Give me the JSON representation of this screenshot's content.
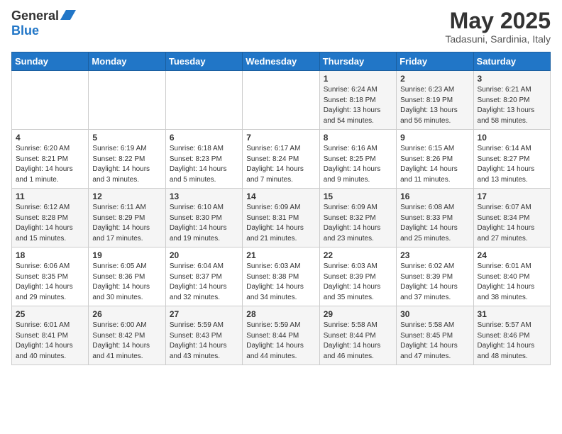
{
  "header": {
    "logo_general": "General",
    "logo_blue": "Blue",
    "month_title": "May 2025",
    "subtitle": "Tadasuni, Sardinia, Italy"
  },
  "days_of_week": [
    "Sunday",
    "Monday",
    "Tuesday",
    "Wednesday",
    "Thursday",
    "Friday",
    "Saturday"
  ],
  "weeks": [
    [
      {
        "day": "",
        "sunrise": "",
        "sunset": "",
        "daylight": ""
      },
      {
        "day": "",
        "sunrise": "",
        "sunset": "",
        "daylight": ""
      },
      {
        "day": "",
        "sunrise": "",
        "sunset": "",
        "daylight": ""
      },
      {
        "day": "",
        "sunrise": "",
        "sunset": "",
        "daylight": ""
      },
      {
        "day": "1",
        "sunrise": "Sunrise: 6:24 AM",
        "sunset": "Sunset: 8:18 PM",
        "daylight": "Daylight: 13 hours and 54 minutes."
      },
      {
        "day": "2",
        "sunrise": "Sunrise: 6:23 AM",
        "sunset": "Sunset: 8:19 PM",
        "daylight": "Daylight: 13 hours and 56 minutes."
      },
      {
        "day": "3",
        "sunrise": "Sunrise: 6:21 AM",
        "sunset": "Sunset: 8:20 PM",
        "daylight": "Daylight: 13 hours and 58 minutes."
      }
    ],
    [
      {
        "day": "4",
        "sunrise": "Sunrise: 6:20 AM",
        "sunset": "Sunset: 8:21 PM",
        "daylight": "Daylight: 14 hours and 1 minute."
      },
      {
        "day": "5",
        "sunrise": "Sunrise: 6:19 AM",
        "sunset": "Sunset: 8:22 PM",
        "daylight": "Daylight: 14 hours and 3 minutes."
      },
      {
        "day": "6",
        "sunrise": "Sunrise: 6:18 AM",
        "sunset": "Sunset: 8:23 PM",
        "daylight": "Daylight: 14 hours and 5 minutes."
      },
      {
        "day": "7",
        "sunrise": "Sunrise: 6:17 AM",
        "sunset": "Sunset: 8:24 PM",
        "daylight": "Daylight: 14 hours and 7 minutes."
      },
      {
        "day": "8",
        "sunrise": "Sunrise: 6:16 AM",
        "sunset": "Sunset: 8:25 PM",
        "daylight": "Daylight: 14 hours and 9 minutes."
      },
      {
        "day": "9",
        "sunrise": "Sunrise: 6:15 AM",
        "sunset": "Sunset: 8:26 PM",
        "daylight": "Daylight: 14 hours and 11 minutes."
      },
      {
        "day": "10",
        "sunrise": "Sunrise: 6:14 AM",
        "sunset": "Sunset: 8:27 PM",
        "daylight": "Daylight: 14 hours and 13 minutes."
      }
    ],
    [
      {
        "day": "11",
        "sunrise": "Sunrise: 6:12 AM",
        "sunset": "Sunset: 8:28 PM",
        "daylight": "Daylight: 14 hours and 15 minutes."
      },
      {
        "day": "12",
        "sunrise": "Sunrise: 6:11 AM",
        "sunset": "Sunset: 8:29 PM",
        "daylight": "Daylight: 14 hours and 17 minutes."
      },
      {
        "day": "13",
        "sunrise": "Sunrise: 6:10 AM",
        "sunset": "Sunset: 8:30 PM",
        "daylight": "Daylight: 14 hours and 19 minutes."
      },
      {
        "day": "14",
        "sunrise": "Sunrise: 6:09 AM",
        "sunset": "Sunset: 8:31 PM",
        "daylight": "Daylight: 14 hours and 21 minutes."
      },
      {
        "day": "15",
        "sunrise": "Sunrise: 6:09 AM",
        "sunset": "Sunset: 8:32 PM",
        "daylight": "Daylight: 14 hours and 23 minutes."
      },
      {
        "day": "16",
        "sunrise": "Sunrise: 6:08 AM",
        "sunset": "Sunset: 8:33 PM",
        "daylight": "Daylight: 14 hours and 25 minutes."
      },
      {
        "day": "17",
        "sunrise": "Sunrise: 6:07 AM",
        "sunset": "Sunset: 8:34 PM",
        "daylight": "Daylight: 14 hours and 27 minutes."
      }
    ],
    [
      {
        "day": "18",
        "sunrise": "Sunrise: 6:06 AM",
        "sunset": "Sunset: 8:35 PM",
        "daylight": "Daylight: 14 hours and 29 minutes."
      },
      {
        "day": "19",
        "sunrise": "Sunrise: 6:05 AM",
        "sunset": "Sunset: 8:36 PM",
        "daylight": "Daylight: 14 hours and 30 minutes."
      },
      {
        "day": "20",
        "sunrise": "Sunrise: 6:04 AM",
        "sunset": "Sunset: 8:37 PM",
        "daylight": "Daylight: 14 hours and 32 minutes."
      },
      {
        "day": "21",
        "sunrise": "Sunrise: 6:03 AM",
        "sunset": "Sunset: 8:38 PM",
        "daylight": "Daylight: 14 hours and 34 minutes."
      },
      {
        "day": "22",
        "sunrise": "Sunrise: 6:03 AM",
        "sunset": "Sunset: 8:39 PM",
        "daylight": "Daylight: 14 hours and 35 minutes."
      },
      {
        "day": "23",
        "sunrise": "Sunrise: 6:02 AM",
        "sunset": "Sunset: 8:39 PM",
        "daylight": "Daylight: 14 hours and 37 minutes."
      },
      {
        "day": "24",
        "sunrise": "Sunrise: 6:01 AM",
        "sunset": "Sunset: 8:40 PM",
        "daylight": "Daylight: 14 hours and 38 minutes."
      }
    ],
    [
      {
        "day": "25",
        "sunrise": "Sunrise: 6:01 AM",
        "sunset": "Sunset: 8:41 PM",
        "daylight": "Daylight: 14 hours and 40 minutes."
      },
      {
        "day": "26",
        "sunrise": "Sunrise: 6:00 AM",
        "sunset": "Sunset: 8:42 PM",
        "daylight": "Daylight: 14 hours and 41 minutes."
      },
      {
        "day": "27",
        "sunrise": "Sunrise: 5:59 AM",
        "sunset": "Sunset: 8:43 PM",
        "daylight": "Daylight: 14 hours and 43 minutes."
      },
      {
        "day": "28",
        "sunrise": "Sunrise: 5:59 AM",
        "sunset": "Sunset: 8:44 PM",
        "daylight": "Daylight: 14 hours and 44 minutes."
      },
      {
        "day": "29",
        "sunrise": "Sunrise: 5:58 AM",
        "sunset": "Sunset: 8:44 PM",
        "daylight": "Daylight: 14 hours and 46 minutes."
      },
      {
        "day": "30",
        "sunrise": "Sunrise: 5:58 AM",
        "sunset": "Sunset: 8:45 PM",
        "daylight": "Daylight: 14 hours and 47 minutes."
      },
      {
        "day": "31",
        "sunrise": "Sunrise: 5:57 AM",
        "sunset": "Sunset: 8:46 PM",
        "daylight": "Daylight: 14 hours and 48 minutes."
      }
    ]
  ]
}
